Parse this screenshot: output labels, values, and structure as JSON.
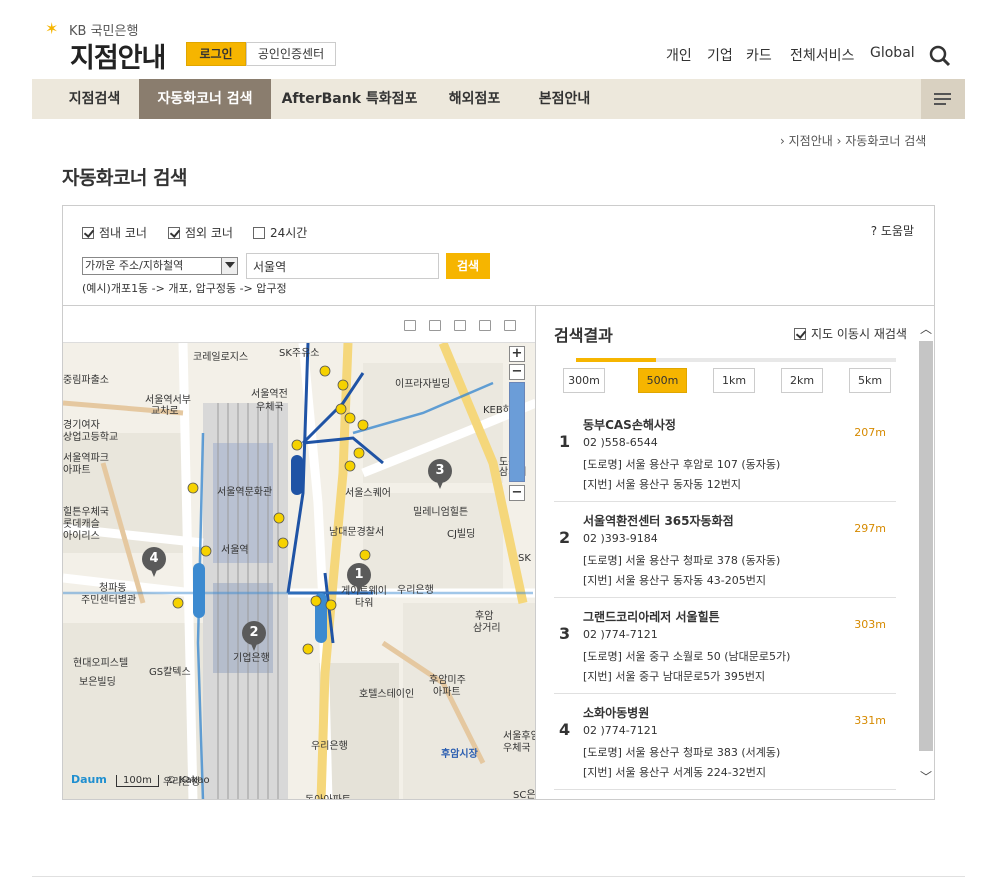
{
  "header": {
    "bank_name": "KB 국민은행",
    "site_title": "지점안내",
    "login_label": "로그인",
    "cert_center_label": "공인인증센터",
    "top_nav": [
      "개인",
      "기업",
      "카드",
      "전체서비스",
      "Global"
    ]
  },
  "menu": {
    "items": [
      "지점검색",
      "자동화코너 검색",
      "AfterBank 특화점포",
      "해외점포",
      "본점안내"
    ],
    "active_index": 1
  },
  "breadcrumb": [
    "지점안내",
    "자동화코너 검색"
  ],
  "page_title": "자동화코너 검색",
  "search": {
    "checkboxes": [
      {
        "label": "점내 코너",
        "checked": true
      },
      {
        "label": "점외 코너",
        "checked": true
      },
      {
        "label": "24시간",
        "checked": false
      }
    ],
    "help_label": "? 도움말",
    "type_select": "가까운 주소/지하철역",
    "keyword": "서울역",
    "search_label": "검색",
    "example": "(예시)개포1동 -> 개포, 압구정동 -> 압구정"
  },
  "map": {
    "labels": [
      "코레일로지스",
      "SK주유소",
      "중림파출소",
      "서울역전",
      "우체국",
      "이프라자빌딩",
      "서울역서부",
      "교차로",
      "KEB하나",
      "경기여자",
      "상업고등학교",
      "서울역파크",
      "아파트",
      "서울역문화관",
      "서울스퀘어",
      "도동",
      "삼거리",
      "힐튼우체국",
      "롯데캐슬",
      "아이리스",
      "서울역",
      "남대문경찰서",
      "CJ빌딩",
      "청파동",
      "주민센터별관",
      "게이트웨이",
      "타워",
      "우리은행",
      "후암",
      "삼거리",
      "현대오피스텔",
      "GS칼텍스",
      "보은빌딩",
      "기업은행",
      "후암미주",
      "아파트",
      "호텔스테이인",
      "우리은행",
      "우리은행",
      "후암시장",
      "서울후암",
      "우체국",
      "동아아파트",
      "SC은",
      "밀레니엄힐튼",
      "SK"
    ],
    "pins": [
      "1",
      "2",
      "3",
      "4"
    ],
    "scale": "100m",
    "logo": "Daum",
    "copyright": "© Kakao"
  },
  "results": {
    "title": "검색결과",
    "redo_label": "지도 이동시 재검색",
    "redo_checked": true,
    "distances": [
      "300m",
      "500m",
      "1km",
      "2km",
      "5km"
    ],
    "active_distance": "500m",
    "items": [
      {
        "num": "1",
        "name": "동부CAS손해사정",
        "phone": "02 )558-6544",
        "road": "[도로명] 서울 용산구 후암로 107 (동자동)",
        "lot": "[지번] 서울 용산구 동자동 12번지",
        "distance": "207m"
      },
      {
        "num": "2",
        "name": "서울역환전센터 365자동화점",
        "phone": "02 )393-9184",
        "road": "[도로명] 서울 용산구 청파로 378 (동자동)",
        "lot": "[지번] 서울 용산구 동자동 43-205번지",
        "distance": "297m"
      },
      {
        "num": "3",
        "name": "그랜드코리아레저 서울힐튼",
        "phone": "02 )774-7121",
        "road": "[도로명] 서울 중구 소월로 50 (남대문로5가)",
        "lot": "[지번] 서울 중구 남대문로5가 395번지",
        "distance": "303m"
      },
      {
        "num": "4",
        "name": "소화아동병원",
        "phone": "02 )774-7121",
        "road": "[도로명] 서울 용산구 청파로 383 (서계동)",
        "lot": "[지번] 서울 용산구 서계동 224-32번지",
        "distance": "331m"
      }
    ]
  },
  "colors": {
    "accent": "#f6b500",
    "menu_bg": "#ede8dc",
    "menu_active": "#8a7d6e",
    "distance_text": "#d68a00",
    "subway": "#1f53a5"
  }
}
